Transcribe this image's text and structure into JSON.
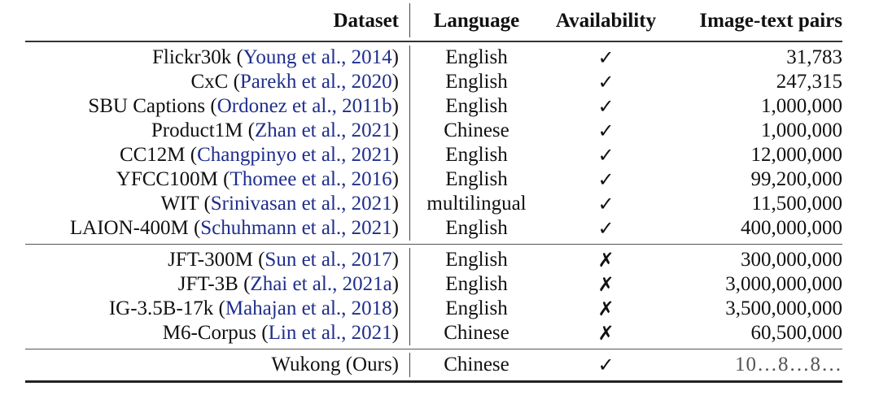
{
  "table": {
    "headers": {
      "dataset": "Dataset",
      "language": "Language",
      "availability": "Availability",
      "pairs": "Image-text pairs"
    },
    "groups": [
      {
        "rows": [
          {
            "name": "Flickr30k",
            "cite_open": " (",
            "cite": "Young et al., 2014",
            "cite_close": ")",
            "language": "English",
            "availability": "✓",
            "available": true,
            "pairs": "31,783"
          },
          {
            "name": "CxC",
            "cite_open": " (",
            "cite": "Parekh et al., 2020",
            "cite_close": ")",
            "language": "English",
            "availability": "✓",
            "available": true,
            "pairs": "247,315"
          },
          {
            "name": "SBU Captions",
            "cite_open": " (",
            "cite": "Ordonez et al., 2011b",
            "cite_close": ")",
            "language": "English",
            "availability": "✓",
            "available": true,
            "pairs": "1,000,000"
          },
          {
            "name": "Product1M",
            "cite_open": " (",
            "cite": "Zhan et al., 2021",
            "cite_close": ")",
            "language": "Chinese",
            "availability": "✓",
            "available": true,
            "pairs": "1,000,000"
          },
          {
            "name": "CC12M",
            "cite_open": " (",
            "cite": "Changpinyo et al., 2021",
            "cite_close": ")",
            "language": "English",
            "availability": "✓",
            "available": true,
            "pairs": "12,000,000"
          },
          {
            "name": "YFCC100M",
            "cite_open": " (",
            "cite": "Thomee et al., 2016",
            "cite_close": ")",
            "language": "English",
            "availability": "✓",
            "available": true,
            "pairs": "99,200,000"
          },
          {
            "name": "WIT",
            "cite_open": " (",
            "cite": "Srinivasan et al., 2021",
            "cite_close": ")",
            "language": "multilingual",
            "availability": "✓",
            "available": true,
            "pairs": "11,500,000"
          },
          {
            "name": "LAION-400M",
            "cite_open": " (",
            "cite": "Schuhmann et al., 2021",
            "cite_close": ")",
            "language": "English",
            "availability": "✓",
            "available": true,
            "pairs": "400,000,000"
          }
        ]
      },
      {
        "rows": [
          {
            "name": "JFT-300M",
            "cite_open": " (",
            "cite": "Sun et al., 2017",
            "cite_close": ")",
            "language": "English",
            "availability": "✗",
            "available": false,
            "pairs": "300,000,000"
          },
          {
            "name": "JFT-3B",
            "cite_open": " (",
            "cite": "Zhai et al., 2021a",
            "cite_close": ")",
            "language": "English",
            "availability": "✗",
            "available": false,
            "pairs": "3,000,000,000"
          },
          {
            "name": "IG-3.5B-17k",
            "cite_open": " (",
            "cite": "Mahajan et al., 2018",
            "cite_close": ")",
            "language": "English",
            "availability": "✗",
            "available": false,
            "pairs": "3,500,000,000"
          },
          {
            "name": "M6-Corpus",
            "cite_open": " (",
            "cite": "Lin et al., 2021",
            "cite_close": ")",
            "language": "Chinese",
            "availability": "✗",
            "available": false,
            "pairs": "60,500,000"
          }
        ]
      },
      {
        "rows": [
          {
            "name": "Wukong (Ours)",
            "cite_open": "",
            "cite": "",
            "cite_close": "",
            "language": "Chinese",
            "availability": "✓",
            "available": true,
            "pairs": "10…8…8…"
          }
        ]
      }
    ]
  },
  "colors": {
    "citation": "#1f2e8c",
    "text": "#111111"
  }
}
